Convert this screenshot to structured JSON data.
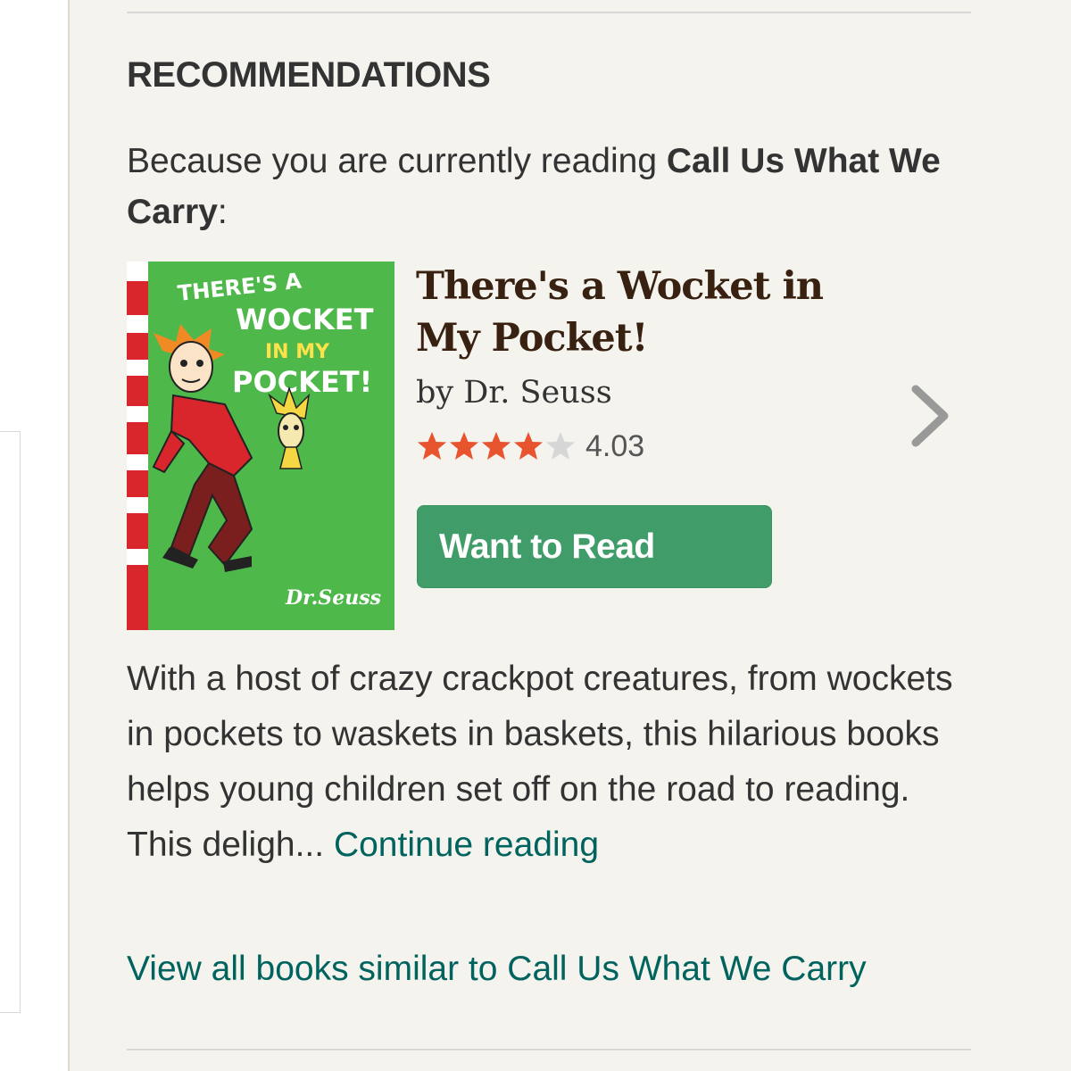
{
  "section": {
    "title": "RECOMMENDATIONS",
    "because_prefix": "Because you are currently reading ",
    "current_book": "Call Us What We Carry",
    "because_suffix": ":"
  },
  "recommendation": {
    "title": "There's a Wocket in My Pocket!",
    "author_line": "by Dr. Seuss",
    "rating": "4.03",
    "rating_stars": 4.03,
    "star_color": "#e8542d",
    "want_to_read_label": "Want to Read",
    "description": "With a host of crazy crackpot creatures, from wockets in pockets to waskets in baskets, this hilarious books helps young children set off on the road to reading. This deligh... ",
    "continue_label": "Continue reading",
    "cover": {
      "line1": "THERE'S A",
      "line2": "WOCKET",
      "line3": "IN MY",
      "line4": "POCKET!",
      "signature": "Dr.Seuss",
      "background": "#4fb84b"
    }
  },
  "footer": {
    "view_all_label": "View all books similar to Call Us What We Carry"
  },
  "icons": {
    "next": "chevron-right-icon",
    "star": "star-icon"
  },
  "colors": {
    "accent_green": "#409d69",
    "link_teal": "#00635d",
    "title_brown": "#382110",
    "background": "#f5f3ee"
  }
}
